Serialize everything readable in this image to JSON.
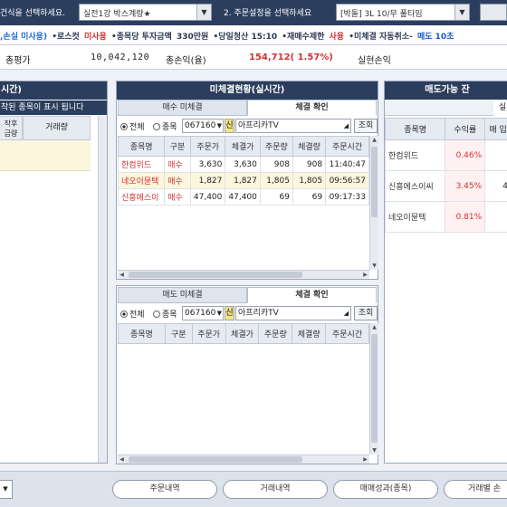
{
  "topbar": {
    "step1_label": "건식을 선택하세요.",
    "step1_select": "실전1강 박스계량★",
    "step2_label": "2. 주문설정을 선택하세요",
    "step2_select": "[박돌] 3L 10/무 풀타임"
  },
  "ticker": {
    "part1": ",손실 미사용)",
    "part2": "•로스컷",
    "part3": "미사용",
    "part4": "•종목당 투자금액",
    "part5": "330만원",
    "part6": "•당일청산 15:10",
    "part7": "•재매수제한",
    "part8": "사용",
    "part9": "•미체결 자동취소-",
    "part10": "매도 10초"
  },
  "summary": {
    "total_eval_label": "총평가",
    "total_eval_value": "10,042,120",
    "total_pnl_label": "총손익(율)",
    "total_pnl_value": "154,712( 1.57%)",
    "realized_label": "실현손익"
  },
  "left_panel": {
    "title": "시간)",
    "col_a": "작후\n금량",
    "col_b": "거래량",
    "message": "착된 종목이 표시 됩니다"
  },
  "mid_panel": {
    "title": "미체결현황(실시간)",
    "tab1": "매수 미체결",
    "tab2": "체결 확인",
    "filter_all": "전체",
    "filter_stock": "종목",
    "code": "067160",
    "stock_name": "아프리카TV",
    "search_btn": "조회",
    "headers": [
      "종목명",
      "구분",
      "주문가",
      "체결가",
      "주문량",
      "체결량",
      "주문시간"
    ],
    "rows": [
      {
        "name": "한컴위드",
        "side": "매수",
        "order_price": "3,630",
        "exec_price": "3,630",
        "order_qty": "908",
        "exec_qty": "908",
        "time": "11:40:47"
      },
      {
        "name": "네오이뮨텍",
        "side": "매수",
        "order_price": "1,827",
        "exec_price": "1,827",
        "order_qty": "1,805",
        "exec_qty": "1,805",
        "time": "09:56:57"
      },
      {
        "name": "신흥에스이",
        "side": "매수",
        "order_price": "47,400",
        "exec_price": "47,400",
        "order_qty": "69",
        "exec_qty": "69",
        "time": "09:17:33"
      }
    ]
  },
  "mid_panel2": {
    "tab1": "매도 미체결",
    "tab2": "체결 확인",
    "filter_all": "전체",
    "filter_stock": "종목",
    "code": "067160",
    "stock_name": "아프리카TV",
    "search_btn": "조회",
    "headers": [
      "종목명",
      "구분",
      "주문가",
      "체결가",
      "주문량",
      "체결량",
      "주문시간"
    ]
  },
  "right_panel": {
    "title": "매도가능 잔",
    "sub_tab": "실",
    "headers": [
      "종목명",
      "수익률",
      "매 입"
    ],
    "rows": [
      {
        "name": "한컴위드",
        "pct": "0.46%",
        "buy": ""
      },
      {
        "name": "신흥에스이씨",
        "pct": "3.45%",
        "buy": "4"
      },
      {
        "name": "네오이뮨텍",
        "pct": "0.81%",
        "buy": ""
      }
    ]
  },
  "bottombar": {
    "btn1": "주문내역",
    "btn2": "거래내역",
    "btn3": "매매성과(종목)",
    "btn4": "거래별 손"
  }
}
